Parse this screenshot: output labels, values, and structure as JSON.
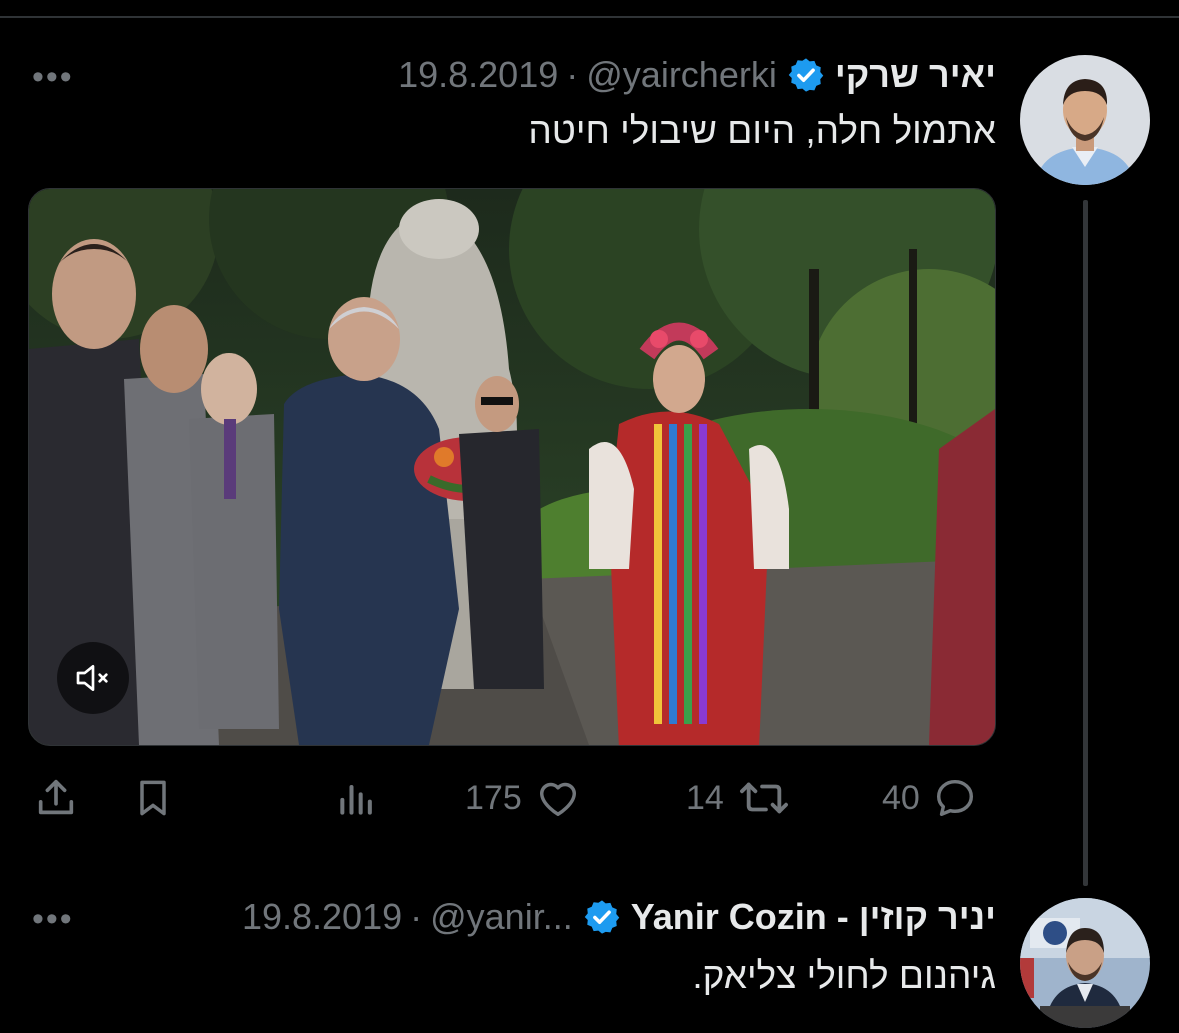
{
  "tweets": [
    {
      "name": "יאיר שרקי",
      "handle": "@yaircherki",
      "separator": "·",
      "date": "19.8.2019",
      "text": "אתמול חלה, היום שיבולי חיטה",
      "verified": true
    },
    {
      "name": "יניר קוזין - Yanir Cozin",
      "handle": "@yanir...",
      "separator": "·",
      "date": "19.8.2019",
      "text": "גיהנום לחולי צליאק.",
      "verified": true
    }
  ],
  "actions": {
    "replies": "40",
    "retweets": "14",
    "likes": "175"
  },
  "icons": {
    "more": "more-dots-icon",
    "verified": "verified-badge-icon",
    "mute": "mute-icon",
    "reply": "reply-icon",
    "retweet": "retweet-icon",
    "like": "heart-icon",
    "views": "views-icon",
    "bookmark": "bookmark-icon",
    "share": "share-icon"
  },
  "colors": {
    "background": "#000000",
    "text": "#e7e9ea",
    "secondary": "#71767b",
    "verified": "#1d9bf0",
    "thread_line": "#333639"
  }
}
